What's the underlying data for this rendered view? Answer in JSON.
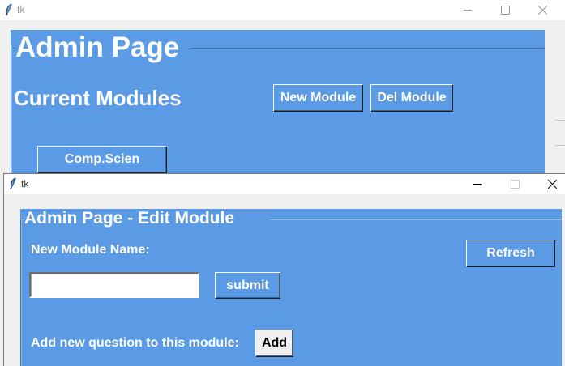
{
  "main_window": {
    "title": "tk",
    "heading": "Admin Page",
    "section_label": "Current Modules",
    "new_module_label": "New Module",
    "del_module_label": "Del Module",
    "modules": [
      "Comp.Scien"
    ]
  },
  "edit_window": {
    "title": "tk",
    "heading": "Admin Page - Edit Module",
    "new_module_name_label": "New Module Name:",
    "module_name_value": "",
    "refresh_label": "Refresh",
    "submit_label": "submit",
    "add_question_label": "Add new question to this module:",
    "add_label": "Add"
  },
  "colors": {
    "frame_bg": "#5b9ae4",
    "window_bg": "#f0f0f0",
    "titlebar_bg": "#ffffff"
  },
  "icons": [
    "feather-icon",
    "minimize-icon",
    "maximize-icon",
    "close-icon"
  ]
}
